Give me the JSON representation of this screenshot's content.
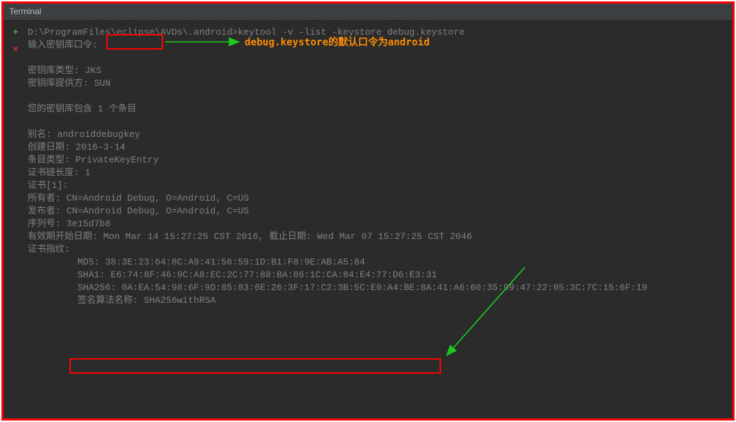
{
  "title": "Terminal",
  "gutter": {
    "plus": "+",
    "cross": "×"
  },
  "prompt": "D:\\ProgramFiles\\eclipse\\AVDs\\.android>keytool -v -list -keystore debug.keystore",
  "pwd_prompt": "输入密钥库口令:",
  "annotation": "debug.keystore的默认口令为android",
  "lines": {
    "blank": " ",
    "ks_type": "密钥库类型: JKS",
    "ks_prov": "密钥库提供方: SUN",
    "ks_count": "您的密钥库包含 1 个条目",
    "alias": "别名: androiddebugkey",
    "created": "创建日期: 2016-3-14",
    "entry": "条目类型: PrivateKeyEntry",
    "chain": "证书链长度: 1",
    "cert": "证书[1]:",
    "owner": "所有者: CN=Android Debug, O=Android, C=US",
    "issuer": "发布者: CN=Android Debug, O=Android, C=US",
    "serial": "序列号: 3e15d7b8",
    "valid": "有效期开始日期: Mon Mar 14 15:27:25 CST 2016, 截止日期: Wed Mar 07 15:27:25 CST 2046",
    "fp": "证书指纹:",
    "md5": "         MD5: 38:3E:23:64:8C:A9:41:56:59:1D:B1:F8:9E:AB:A5:84",
    "sha1": "         SHA1: E6:74:8F:46:9C:A8:EC:2C:77:88:BA:86:1C:CA:84:E4:77:D6:E3:31",
    "sha256": "         SHA256: 0A:EA:54:98:6F:9D:85:83:6E:26:3F:17:C2:3B:5C:E0:A4:BE:8A:41:A6:60:35:99:47:22:05:3C:7C:15:6F:19",
    "sigalg": "         签名算法名称: SHA256withRSA"
  },
  "colors": {
    "border": "#ff0000",
    "arrow": "#1ec81e",
    "annot": "#ff8c00"
  }
}
